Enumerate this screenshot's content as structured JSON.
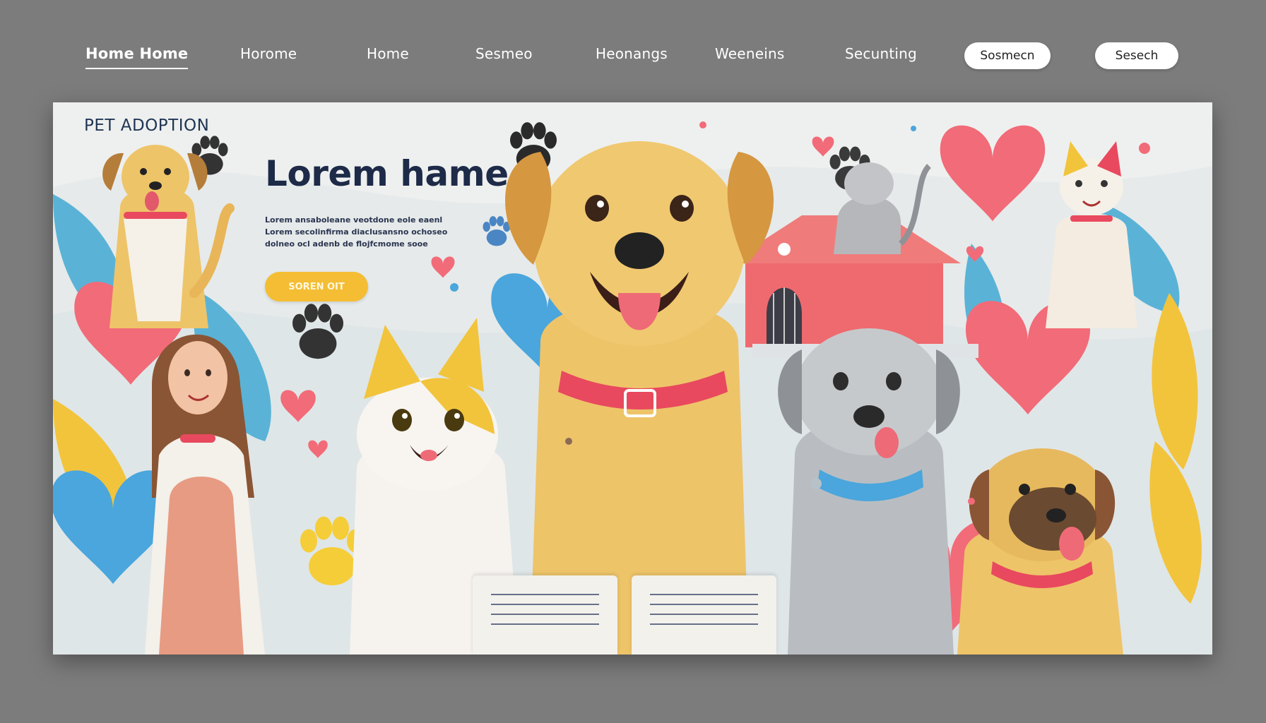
{
  "nav": {
    "links": [
      {
        "label": "Home Home",
        "active": true
      },
      {
        "label": "Horome"
      },
      {
        "label": "Home"
      },
      {
        "label": "Sesmeo"
      },
      {
        "label": "Heonangs"
      },
      {
        "label": "Weeneins"
      },
      {
        "label": "Secunting"
      }
    ],
    "pills": [
      "Sosmecn",
      "Sesech"
    ]
  },
  "hero": {
    "eyebrow": "PET ADOPTION",
    "headline": "Lorem hame",
    "body": "Lorem ansaboleane veotdone eole eaenl Lorem secolinfirma diaclusansno ochoseo dolneo ocl adenb de flojfcmome sooe",
    "cta": "SOREN OIT"
  },
  "colors": {
    "background": "#7c7c7c",
    "hero_bg": "#eef0ef",
    "cta": "#f4bd33",
    "heart_pink": "#f26b78",
    "heart_blue": "#4aa6dc",
    "dog_gold": "#eec469",
    "collar_red": "#e8495e",
    "navy_text": "#1d2a48"
  },
  "icons": [
    "paw-icon",
    "heart-icon",
    "dog-house-icon"
  ]
}
